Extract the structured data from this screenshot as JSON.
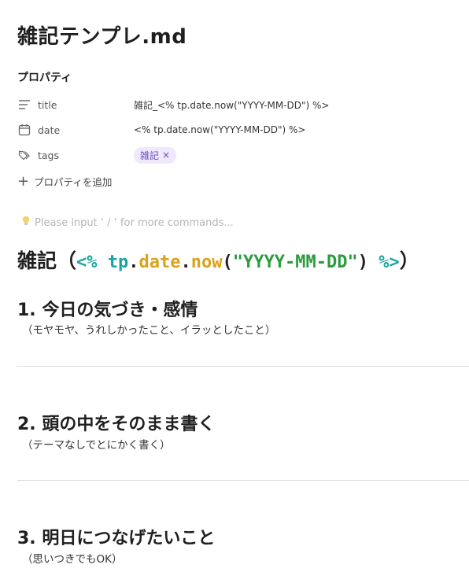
{
  "document": {
    "title": "雑記テンプレ.md"
  },
  "properties": {
    "heading": "プロパティ",
    "rows": [
      {
        "icon": "text-lines-icon",
        "key": "title",
        "value": "雑記_<% tp.date.now(\"YYYY-MM-DD\") %>"
      },
      {
        "icon": "calendar-icon",
        "key": "date",
        "value": "<% tp.date.now(\"YYYY-MM-DD\") %>"
      },
      {
        "icon": "tags-icon",
        "key": "tags",
        "tag": "雑記",
        "tag_remove": "×"
      }
    ],
    "add_label": "プロパティを追加"
  },
  "editor": {
    "placeholder": "Please input ‘ / ’ for more commands..."
  },
  "content": {
    "h1": {
      "prefix": "雑記",
      "paren_open": "（",
      "tpl_open": "<%",
      "space": " ",
      "obj": "tp",
      "dot1": ".",
      "prop": "date",
      "dot2": ".",
      "method": "now",
      "arg_open": "(",
      "arg": "\"YYYY-MM-DD\"",
      "arg_close": ")",
      "tpl_close": "%>",
      "paren_close": "）"
    },
    "sections": [
      {
        "heading": "1. 今日の気づき・感情",
        "sub": "（モヤモヤ、うれしかったこと、イラッとしたこと）"
      },
      {
        "heading": "2. 頭の中をそのまま書く",
        "sub": "（テーマなしでとにかく書く）"
      },
      {
        "heading": "3. 明日につなげたいこと",
        "sub": "（思いつきでもOK）"
      }
    ]
  },
  "colors": {
    "tag_bg": "#efe9fb",
    "tag_text": "#6a4cc2",
    "teal": "#1aa5a0",
    "orange": "#d9a21a",
    "green": "#2c9c3f"
  }
}
